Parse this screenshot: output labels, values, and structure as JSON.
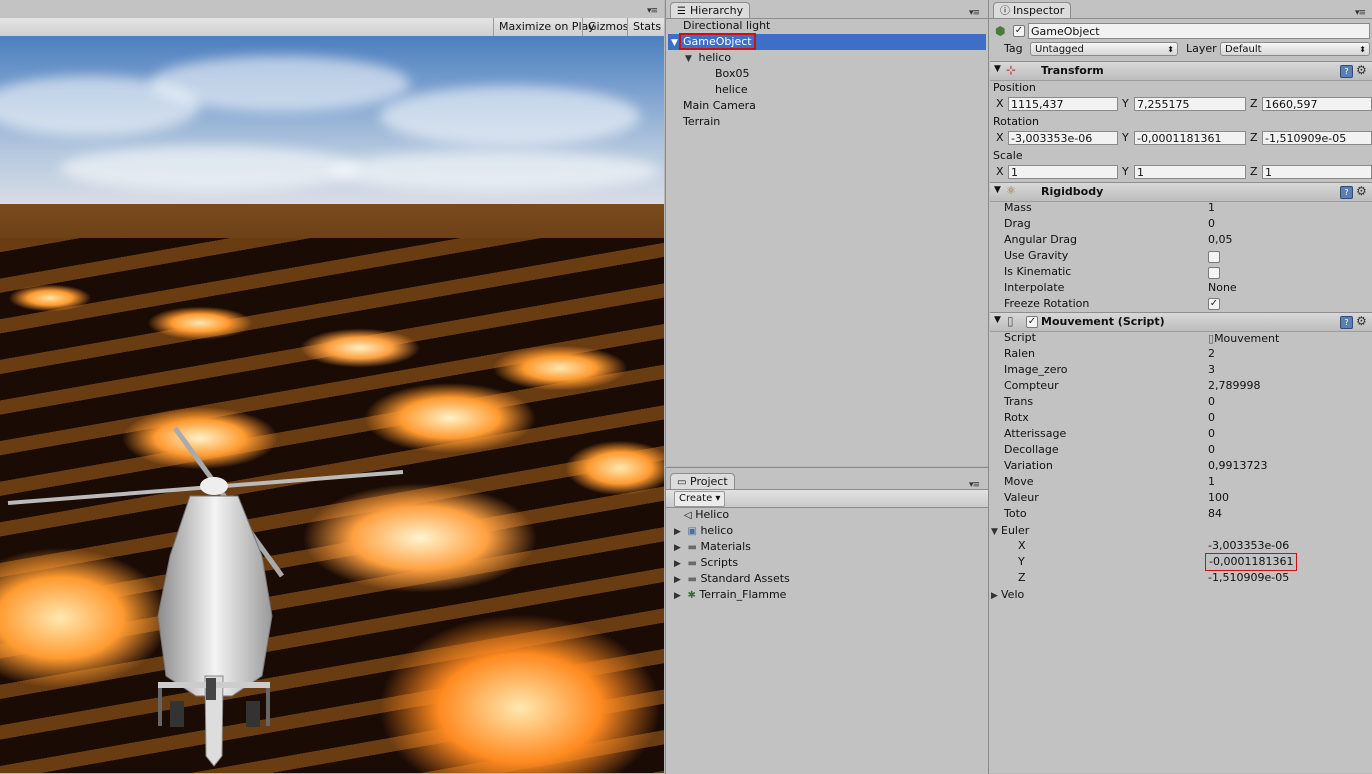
{
  "game": {
    "toolbar": {
      "maximize": "Maximize on Play",
      "gizmos": "Gizmos",
      "stats": "Stats"
    }
  },
  "hierarchy": {
    "tab": "Hierarchy",
    "items": [
      {
        "label": "Directional light"
      },
      {
        "label": "GameObject"
      },
      {
        "label": "helico"
      },
      {
        "label": "Box05"
      },
      {
        "label": "helice"
      },
      {
        "label": "Main Camera"
      },
      {
        "label": "Terrain"
      }
    ]
  },
  "project": {
    "tab": "Project",
    "create": "Create",
    "items": [
      {
        "label": "Helico"
      },
      {
        "label": "helico"
      },
      {
        "label": "Materials"
      },
      {
        "label": "Scripts"
      },
      {
        "label": "Standard Assets"
      },
      {
        "label": "Terrain_Flamme"
      }
    ]
  },
  "inspector": {
    "tab": "Inspector",
    "object_name": "GameObject",
    "tag_label": "Tag",
    "tag_value": "Untagged",
    "layer_label": "Layer",
    "layer_value": "Default",
    "transform": {
      "title": "Transform",
      "position_label": "Position",
      "rotation_label": "Rotation",
      "scale_label": "Scale",
      "axis_x": "X",
      "axis_y": "Y",
      "axis_z": "Z",
      "position": {
        "x": "1115,437",
        "y": "7,255175",
        "z": "1660,597"
      },
      "rotation": {
        "x": "-3,003353e-06",
        "y": "-0,0001181361",
        "z": "-1,510909e-05"
      },
      "scale": {
        "x": "1",
        "y": "1",
        "z": "1"
      }
    },
    "rigidbody": {
      "title": "Rigidbody",
      "mass_label": "Mass",
      "mass": "1",
      "drag_label": "Drag",
      "drag": "0",
      "angular_drag_label": "Angular Drag",
      "angular_drag": "0,05",
      "use_gravity_label": "Use Gravity",
      "is_kinematic_label": "Is Kinematic",
      "interpolate_label": "Interpolate",
      "interpolate": "None",
      "freeze_rotation_label": "Freeze Rotation",
      "check_mark": "✓"
    },
    "script": {
      "title": "Mouvement (Script)",
      "fields": [
        {
          "label": "Script",
          "value": "Mouvement"
        },
        {
          "label": "Ralen",
          "value": "2"
        },
        {
          "label": "Image_zero",
          "value": "3"
        },
        {
          "label": "Compteur",
          "value": "2,789998"
        },
        {
          "label": "Trans",
          "value": "0"
        },
        {
          "label": "Rotx",
          "value": "0"
        },
        {
          "label": "Atterissage",
          "value": "0"
        },
        {
          "label": "Decollage",
          "value": "0"
        },
        {
          "label": "Variation",
          "value": "0,9913723"
        },
        {
          "label": "Move",
          "value": "1"
        },
        {
          "label": "Valeur",
          "value": "100"
        },
        {
          "label": "Toto",
          "value": "84"
        }
      ],
      "euler_label": "Euler",
      "euler": [
        {
          "label": "X",
          "value": "-3,003353e-06"
        },
        {
          "label": "Y",
          "value": "-0,0001181361"
        },
        {
          "label": "Z",
          "value": "-1,510909e-05"
        }
      ],
      "velo_label": "Velo"
    }
  }
}
